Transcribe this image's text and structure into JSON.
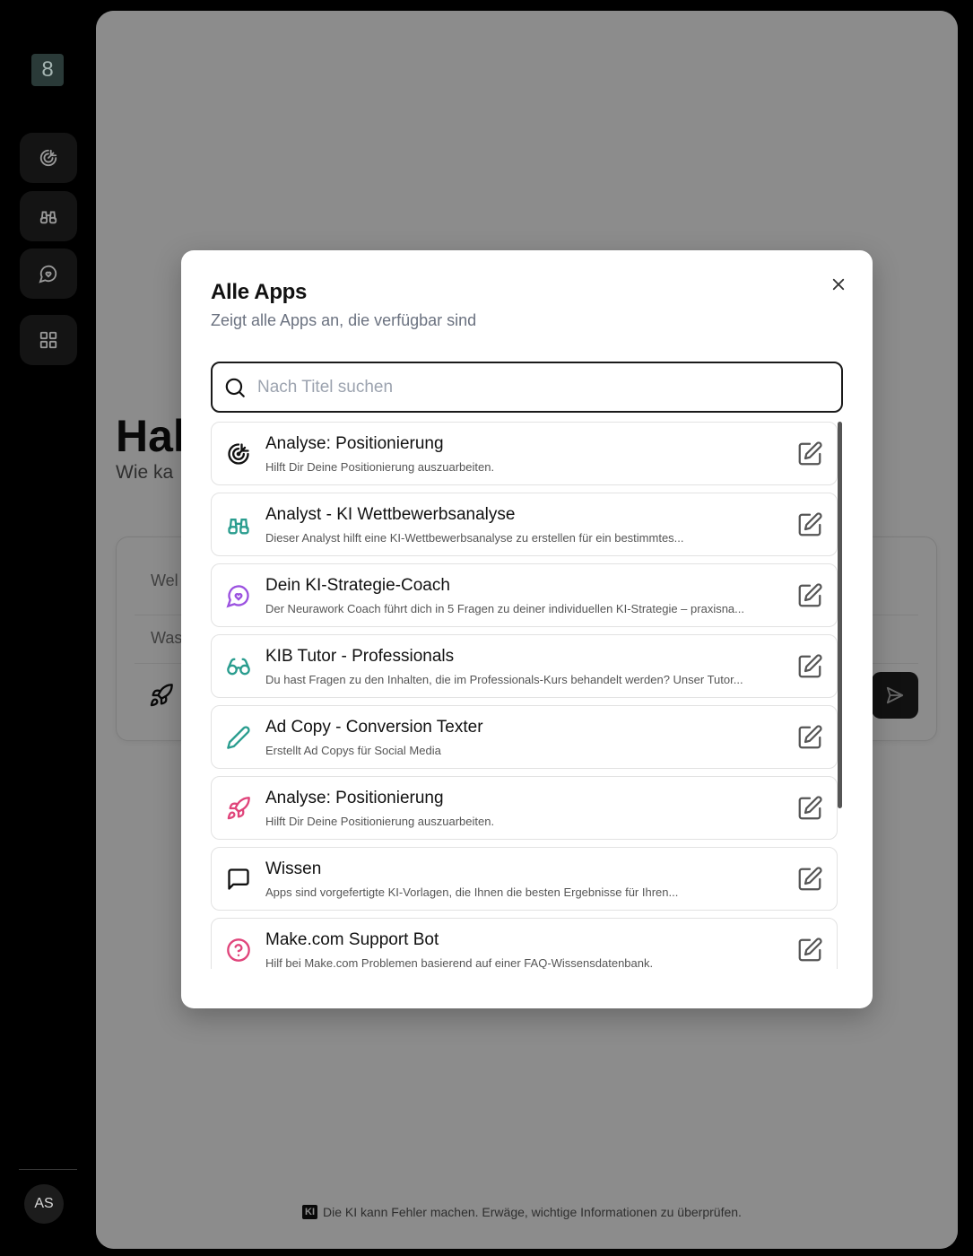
{
  "sidebar": {
    "logo": "8",
    "avatar": "AS"
  },
  "background": {
    "greeting": "Hal",
    "greeting_sub": "Wie ka",
    "chat_line_1": "Wel",
    "chat_line_2": "Was",
    "disclaimer_badge": "KI",
    "disclaimer": "Die KI kann Fehler machen. Erwäge, wichtige Informationen zu überprüfen."
  },
  "modal": {
    "title": "Alle Apps",
    "subtitle": "Zeigt alle Apps an, die verfügbar sind",
    "search_placeholder": "Nach Titel suchen",
    "search_value": "",
    "apps": [
      {
        "title": "Analyse: Positionierung",
        "desc": "Hilft Dir Deine Positionierung auszuarbeiten.",
        "icon": "target-icon",
        "color": "#111111"
      },
      {
        "title": "Analyst - KI Wettbewerbsanalyse",
        "desc": "Dieser Analyst hilft eine KI-Wettbewerbsanalyse zu erstellen für ein bestimmtes...",
        "icon": "binoculars-icon",
        "color": "#2a9d8f"
      },
      {
        "title": "Dein KI-Strategie-Coach",
        "desc": "Der Neurawork Coach führt dich in 5 Fragen zu deiner individuellen KI-Strategie – praxisna...",
        "icon": "message-heart-icon",
        "color": "#9b51e0"
      },
      {
        "title": "KIB Tutor - Professionals",
        "desc": "Du hast Fragen zu den Inhalten, die im Professionals-Kurs behandelt werden? Unser Tutor...",
        "icon": "glasses-icon",
        "color": "#2a9d8f"
      },
      {
        "title": "Ad Copy - Conversion Texter",
        "desc": "Erstellt Ad Copys für Social Media",
        "icon": "pencil-icon",
        "color": "#2a9d8f"
      },
      {
        "title": "Analyse: Positionierung",
        "desc": "Hilft Dir Deine Positionierung auszuarbeiten.",
        "icon": "rocket-icon",
        "color": "#e0457b"
      },
      {
        "title": "Wissen",
        "desc": "Apps sind vorgefertigte KI-Vorlagen, die Ihnen die besten Ergebnisse für Ihren...",
        "icon": "message-square-icon",
        "color": "#111111"
      },
      {
        "title": "Make.com Support Bot",
        "desc": "Hilf bei Make.com Problemen basierend auf einer FAQ-Wissensdatenbank.",
        "icon": "help-circle-icon",
        "color": "#e0457b"
      }
    ]
  }
}
